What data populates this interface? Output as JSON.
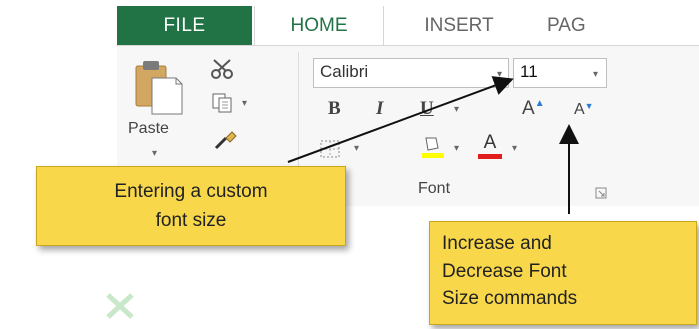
{
  "tabs": {
    "file": "FILE",
    "home": "HOME",
    "insert": "INSERT",
    "page_layout_partial": "PAG"
  },
  "clipboard": {
    "paste_label": "Paste",
    "icons": [
      "paste-icon",
      "cut-icon",
      "copy-icon",
      "format-painter-icon"
    ]
  },
  "font": {
    "name_value": "Calibri",
    "size_value": "11",
    "bold": "B",
    "italic": "I",
    "underline": "U",
    "grow": "A",
    "shrink": "A",
    "font_color": "A",
    "group_label": "Font",
    "icons": [
      "borders-icon",
      "fill-color-icon",
      "font-color-icon",
      "dialog-launcher-icon"
    ]
  },
  "callouts": {
    "custom_size": [
      "Entering a custom",
      "font size"
    ],
    "grow_shrink": [
      "Increase and",
      "Decrease Font",
      "Size commands"
    ]
  },
  "colors": {
    "file_tab": "#217346",
    "callout": "#f8d84a",
    "fill_highlight": "#ffff00",
    "font_color_bar": "#e21d1d"
  }
}
